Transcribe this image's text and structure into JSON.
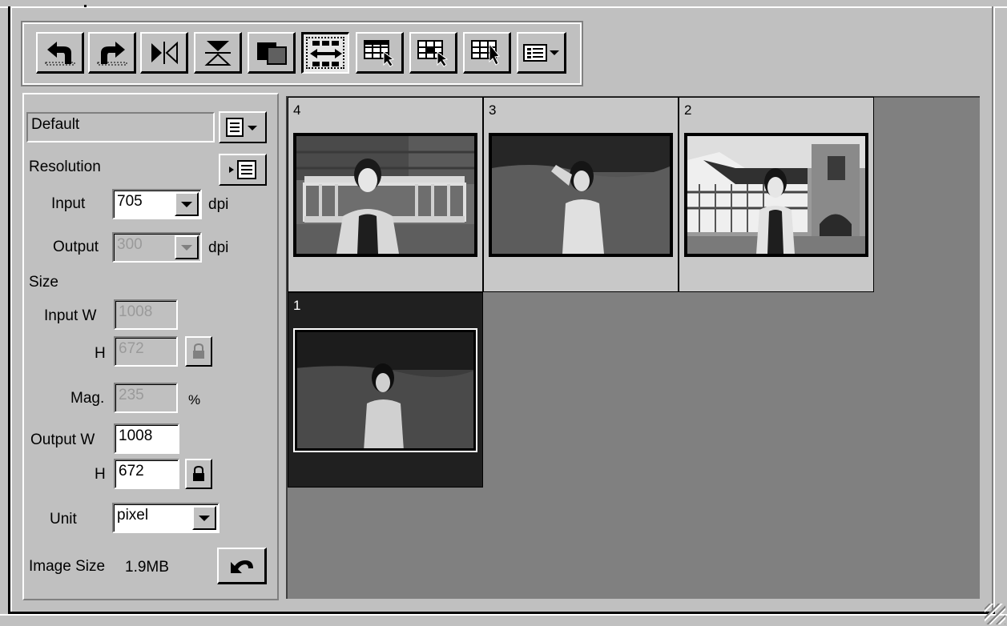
{
  "toolbar": {
    "buttons": [
      {
        "name": "rotate-left-button",
        "icon": "rotate-left-icon"
      },
      {
        "name": "rotate-right-button",
        "icon": "rotate-right-icon"
      },
      {
        "name": "flip-horizontal-button",
        "icon": "flip-horizontal-icon"
      },
      {
        "name": "flip-vertical-button",
        "icon": "flip-vertical-icon"
      },
      {
        "name": "negative-positive-button",
        "icon": "overlap-squares-icon"
      },
      {
        "name": "thumbnail-layout-button",
        "icon": "horizontal-arrows-icon",
        "pressed": true
      },
      {
        "name": "grid-view-1-button",
        "icon": "grid-cursor-icon"
      },
      {
        "name": "grid-view-2-button",
        "icon": "grid-cursor-icon"
      },
      {
        "name": "grid-view-3-button",
        "icon": "grid-cursor-icon"
      },
      {
        "name": "view-options-dropdown",
        "icon": "list-dropdown-icon"
      }
    ]
  },
  "settings": {
    "preset": "Default",
    "resolution_label": "Resolution",
    "input_label": "Input",
    "input_dpi": "705",
    "output_label": "Output",
    "output_dpi": "300",
    "dpi_unit": "dpi",
    "size_label": "Size",
    "input_w_label": "Input W",
    "input_w": "1008",
    "h_label": "H",
    "input_h": "672",
    "mag_label": "Mag.",
    "mag": "235",
    "mag_unit": "%",
    "output_w_label": "Output W",
    "output_w": "1008",
    "output_h": "672",
    "unit_label": "Unit",
    "unit": "pixel",
    "image_size_label": "Image Size",
    "image_size": "1.9MB"
  },
  "thumbnails": [
    {
      "number": "4",
      "selected": false,
      "scene": "woman-on-bench"
    },
    {
      "number": "3",
      "selected": false,
      "scene": "woman-in-park"
    },
    {
      "number": "2",
      "selected": false,
      "scene": "woman-before-building"
    },
    {
      "number": "1",
      "selected": true,
      "scene": "woman-on-lawn"
    }
  ],
  "colors": {
    "face": "#c0c0c0",
    "thumb_area": "#808080",
    "selected": "#202020"
  }
}
